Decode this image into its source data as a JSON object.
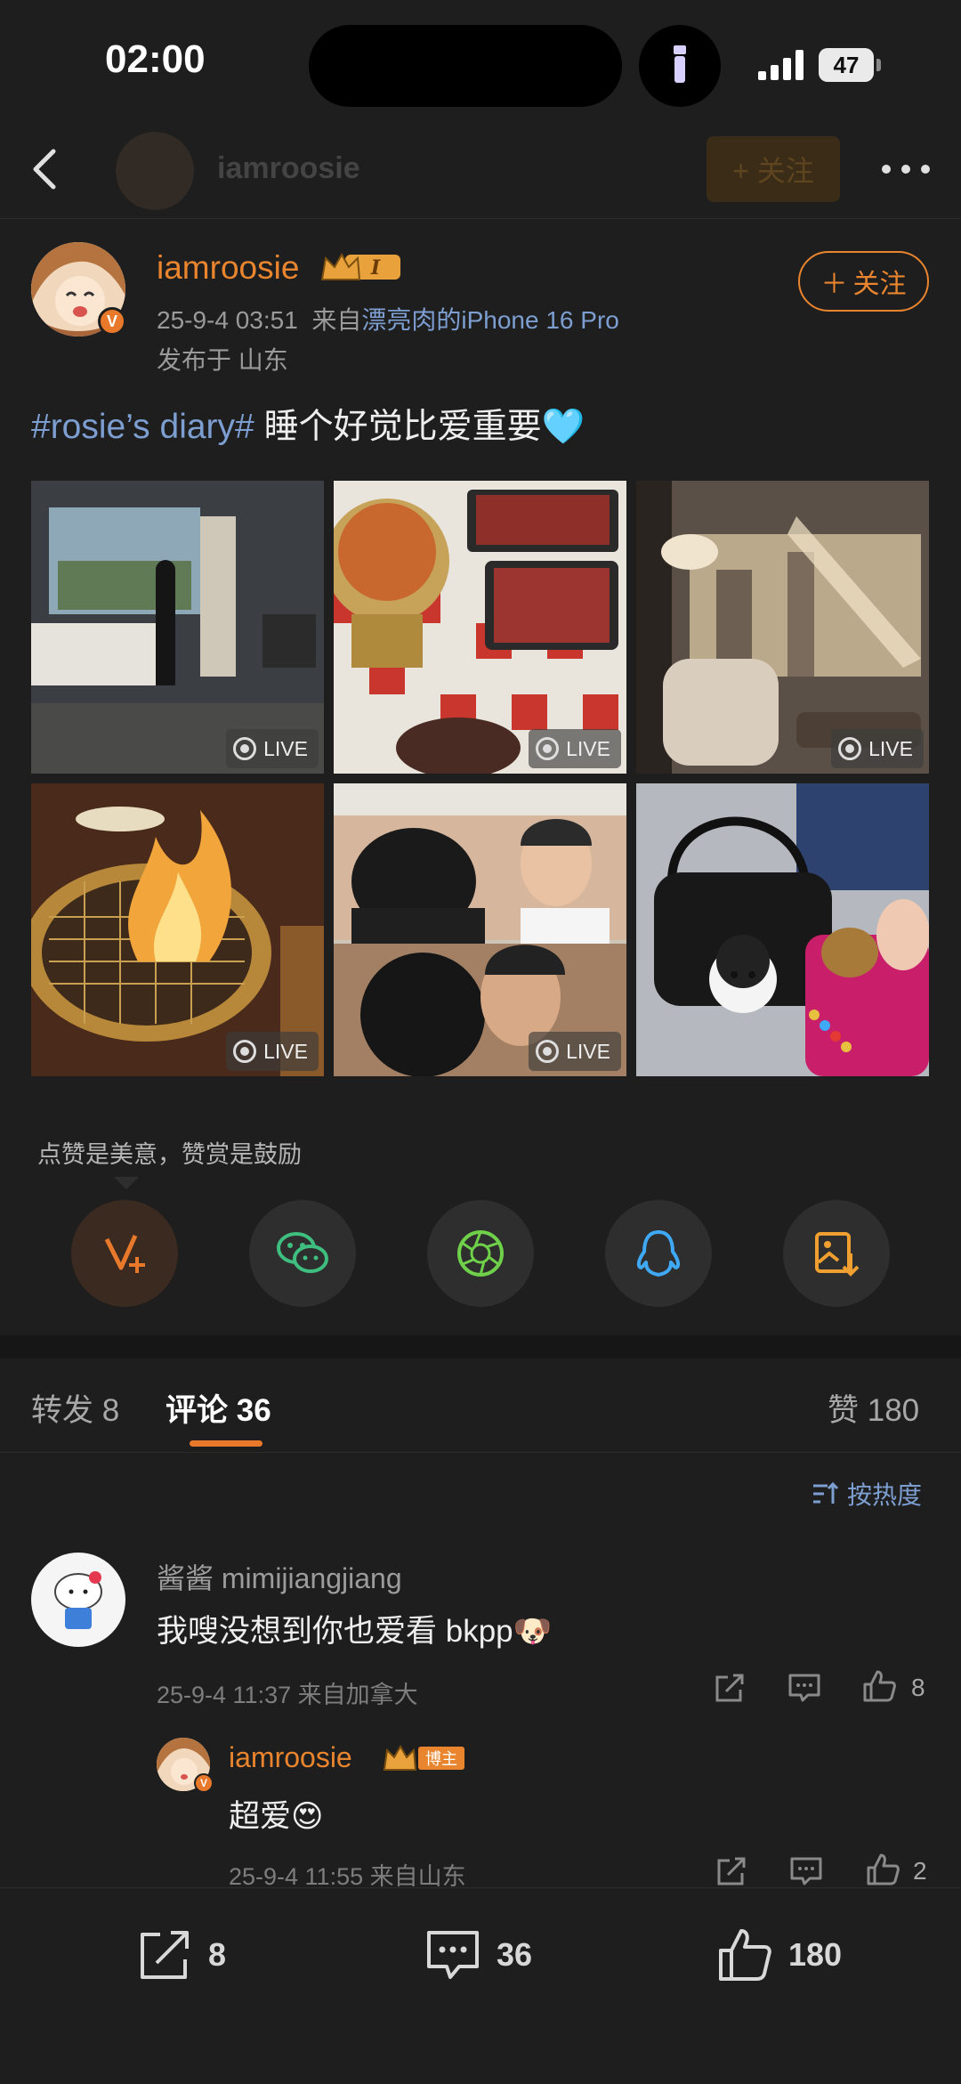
{
  "status_bar": {
    "time": "02:00",
    "battery": "47"
  },
  "nav": {
    "username": "iamroosie",
    "follow_label": "+ 关注"
  },
  "post": {
    "username": "iamroosie",
    "vip_level": "I",
    "time": "25-9-4 03:51",
    "source_prefix": "来自",
    "device": "漂亮肉的iPhone 16 Pro",
    "region": "发布于 山东",
    "follow_label": "关注",
    "hashtag": "#rosie’s diary#",
    "text": " 睡个好觉比爱重要",
    "emoji": "🩵",
    "photos": [
      {
        "subject": "hotel-room",
        "live": "LIVE"
      },
      {
        "subject": "hotpot-meat",
        "live": "LIVE"
      },
      {
        "subject": "lounge-chair",
        "live": "LIVE"
      },
      {
        "subject": "bbq-grill-flame",
        "live": "LIVE"
      },
      {
        "subject": "drama-stills",
        "live": "LIVE"
      },
      {
        "subject": "bag-charm",
        "live": ""
      }
    ]
  },
  "reward": {
    "text": "点赞是美意，赞赏是鼓励"
  },
  "tabs": {
    "repost": "转发 8",
    "comments": "评论 36",
    "likes": "赞 180"
  },
  "sort": {
    "label": "按热度"
  },
  "comments": [
    {
      "name": "酱酱 mimijiangjiang",
      "text": "我嗖没想到你也爱看 bkpp",
      "emoji": "🐶",
      "meta": "25-9-4 11:37  来自加拿大",
      "likes": "8"
    }
  ],
  "reply": {
    "name": "iamroosie",
    "badge": "博主",
    "text": "超爱",
    "emoji": "😍",
    "meta": "25-9-4 11:55  来自山东",
    "likes": "2"
  },
  "bottom_bar": {
    "repost": "8",
    "comment": "36",
    "like": "180"
  },
  "colors": {
    "accent": "#e8782a",
    "link": "#7d9ed0",
    "background": "#1e1e1e"
  }
}
